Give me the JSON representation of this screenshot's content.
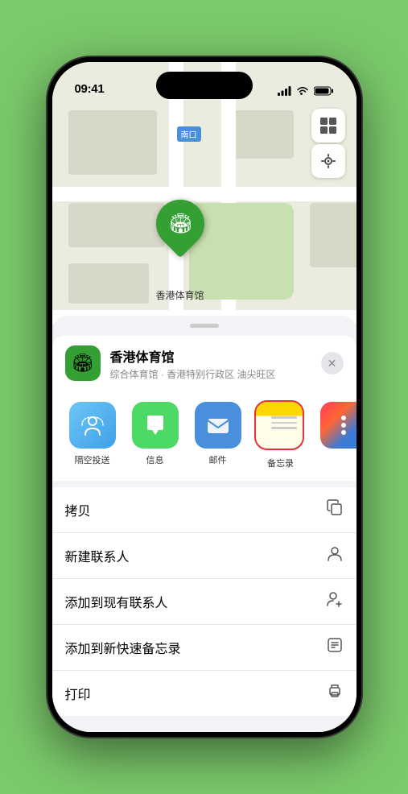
{
  "status": {
    "time": "09:41",
    "location_icon": "▶",
    "battery_full": true
  },
  "map": {
    "label_text": "南口",
    "venue_name": "香港体育馆",
    "venue_subtitle": "综合体育馆 · 香港特别行政区 油尖旺区",
    "close_btn": "×"
  },
  "share_row": {
    "items": [
      {
        "id": "airdrop",
        "label": "隔空投送"
      },
      {
        "id": "messages",
        "label": "信息"
      },
      {
        "id": "mail",
        "label": "邮件"
      },
      {
        "id": "notes",
        "label": "备忘录"
      }
    ]
  },
  "actions": [
    {
      "label": "拷贝",
      "icon": "copy"
    },
    {
      "label": "新建联系人",
      "icon": "person"
    },
    {
      "label": "添加到现有联系人",
      "icon": "person-add"
    },
    {
      "label": "添加到新快速备忘录",
      "icon": "note"
    },
    {
      "label": "打印",
      "icon": "printer"
    }
  ]
}
